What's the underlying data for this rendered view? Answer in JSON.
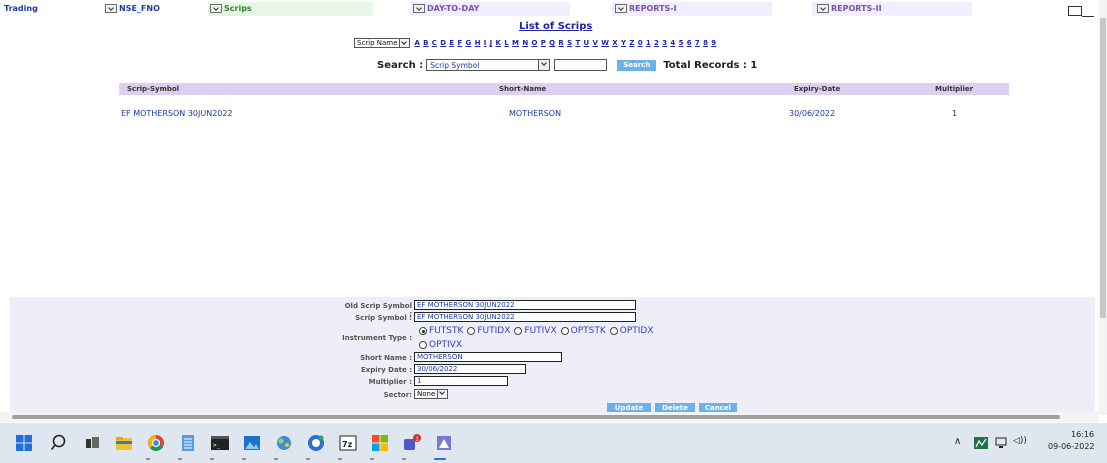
{
  "nav": {
    "trading": "Trading",
    "nse_fno": "NSE_FNO",
    "scrips": "Scrips",
    "day_to_day": "DAY-TO-DAY",
    "reports_1": "REPORTS-I",
    "reports_2": "REPORTS-II"
  },
  "page_title": "List of Scrips",
  "alpha_filter": {
    "selected": "Scrip Name",
    "letters": [
      "A",
      "B",
      "C",
      "D",
      "E",
      "F",
      "G",
      "H",
      "I",
      "J",
      "K",
      "L",
      "M",
      "N",
      "O",
      "P",
      "Q",
      "R",
      "S",
      "T",
      "U",
      "V",
      "W",
      "X",
      "Y",
      "Z",
      "0",
      "1",
      "2",
      "3",
      "4",
      "5",
      "6",
      "7",
      "8",
      "9"
    ]
  },
  "search": {
    "label": "Search :",
    "field_selected": "Scrip Symbol",
    "input_value": "",
    "button": "Search",
    "total_records": "Total Records : 1"
  },
  "table": {
    "headers": [
      "Scrip-Symbol",
      "Short-Name",
      "Expiry-Date",
      "Multiplier"
    ],
    "rows": [
      [
        "EF MOTHERSON 30JUN2022",
        "MOTHERSON",
        "30/06/2022",
        "1"
      ]
    ]
  },
  "form": {
    "old_scrip_symbol_label": "Old Scrip Symbol :",
    "old_scrip_symbol_value": "EF MOTHERSON 30JUN2022",
    "scrip_symbol_label": "Scrip Symbol :",
    "scrip_symbol_value": "EF MOTHERSON 30JUN2022",
    "instrument_type_label": "Instrument Type :",
    "instrument_types": [
      "FUTSTK",
      "FUTIDX",
      "FUTIVX",
      "OPTSTK",
      "OPTIDX",
      "OPTIVX"
    ],
    "instrument_selected": "FUTSTK",
    "short_name_label": "Short Name :",
    "short_name_value": "MOTHERSON",
    "expiry_date_label": "Expiry Date :",
    "expiry_date_value": "30/06/2022",
    "multiplier_label": "Multiplier :",
    "multiplier_value": "1",
    "sector_label": "Sector:",
    "sector_value": "None",
    "update_button": "Update",
    "delete_button": "Delete",
    "cancel_button": "Cancel"
  },
  "taskbar": {
    "time": "16:16",
    "date": "09-06-2022"
  }
}
